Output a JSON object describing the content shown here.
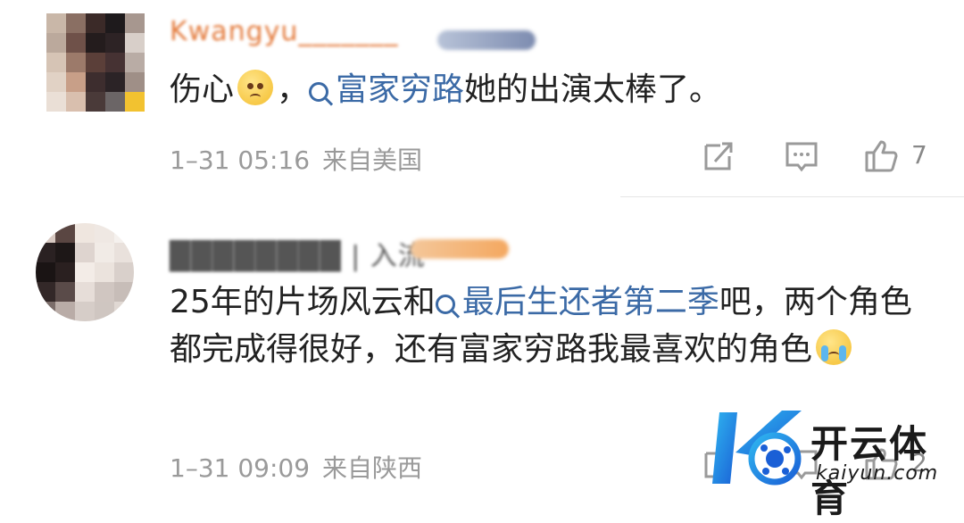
{
  "comments": [
    {
      "username": "Kwangyu_______",
      "text_prefix": "伤心",
      "emoji": "sad-face-emoji",
      "text_comma": "，",
      "topic": "富家穷路",
      "text_suffix": "她的出演太棒了。",
      "date": "1–31 05:16",
      "location": "来自美国",
      "like_count": "7"
    },
    {
      "username": "████████ | 入流",
      "text_1": "25年的片场风云和",
      "topic": "最后生还者第二季",
      "text_2": "吧，两个角色都完成得很好，还有富家穷路我最喜欢的角色",
      "emoji": "crying-face-emoji",
      "date": "1–31 09:09",
      "location": "来自陕西",
      "like_count": "2"
    }
  ],
  "watermark": {
    "title": "开云体育",
    "subtitle": "kaiyun.com"
  },
  "colors": {
    "topic": "#3b6aa6",
    "meta": "#9a9a9a",
    "icon": "#9a9a9a"
  }
}
